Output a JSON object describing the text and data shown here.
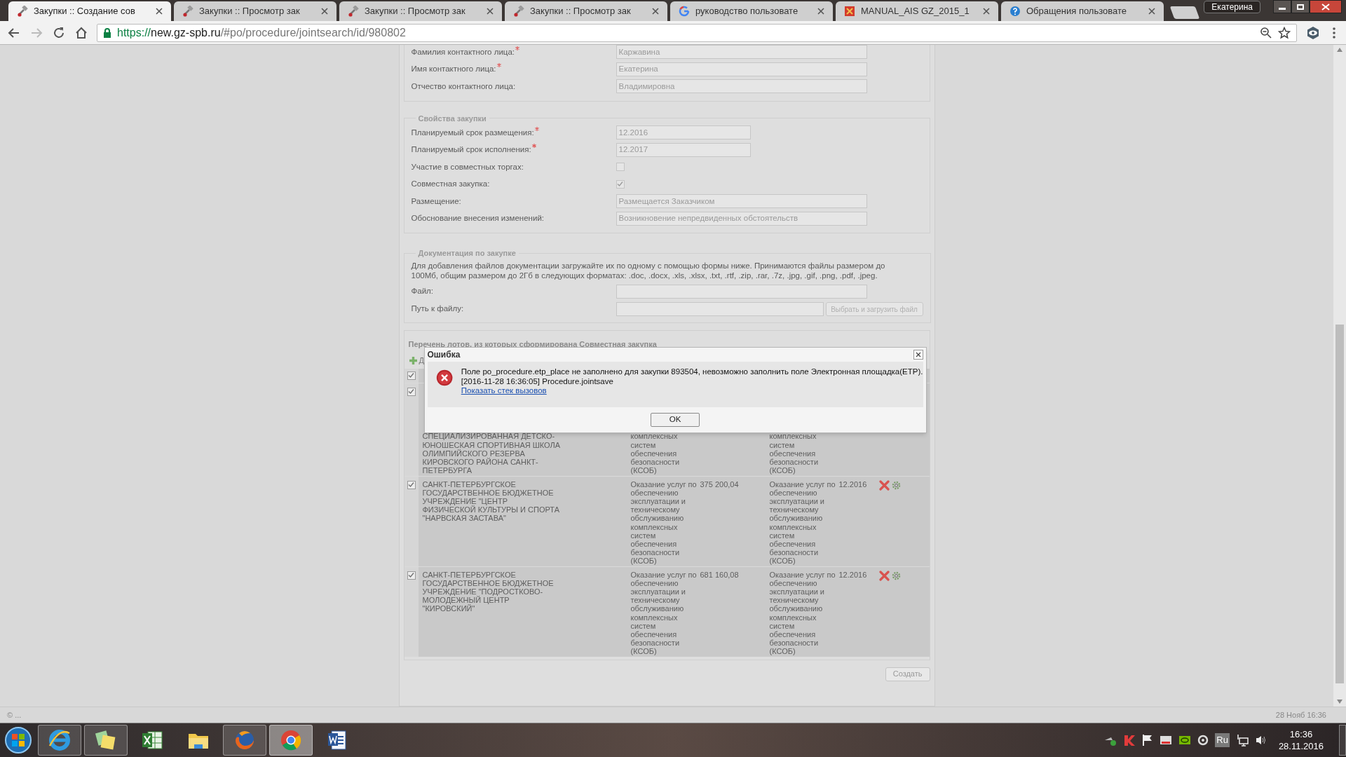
{
  "browser": {
    "tabs": [
      {
        "title": "Закупки :: Создание сов",
        "kind": "gavel",
        "selected": true
      },
      {
        "title": "Закупки :: Просмотр зак",
        "kind": "gavel",
        "selected": false
      },
      {
        "title": "Закупки :: Просмотр зак",
        "kind": "gavel",
        "selected": false
      },
      {
        "title": "Закупки :: Просмотр зак",
        "kind": "gavel",
        "selected": false
      },
      {
        "title": "руководство пользовате",
        "kind": "google",
        "selected": false
      },
      {
        "title": "MANUAL_AIS GZ_2015_1",
        "kind": "crest",
        "selected": false
      },
      {
        "title": "Обращения пользовате",
        "kind": "help",
        "selected": false
      }
    ],
    "profile": "Екатерина",
    "url": {
      "scheme": "https://",
      "host": "new.gz-spb.ru",
      "path": "/#po/procedure/jointsearch/id/980802"
    }
  },
  "sections": [
    {
      "rows": [
        {
          "label": "Фамилия контактного лица:",
          "required": true,
          "kind": "text",
          "value": "Каржавина"
        },
        {
          "label": "Имя контактного лица:",
          "required": true,
          "kind": "text",
          "value": "Екатерина"
        },
        {
          "label": "Отчество контактного лица:",
          "required": false,
          "kind": "text",
          "value": "Владимировна"
        }
      ]
    },
    {
      "legend": "Свойства закупки",
      "rows": [
        {
          "label": "Планируемый срок размещения:",
          "required": true,
          "kind": "short",
          "value": "12.2016"
        },
        {
          "label": "Планируемый срок исполнения:",
          "required": true,
          "kind": "short",
          "value": "12.2017"
        },
        {
          "label": "Участие в совместных торгах:",
          "required": false,
          "kind": "checkbox",
          "checked": false
        },
        {
          "label": "Совместная закупка:",
          "required": false,
          "kind": "checkbox",
          "checked": true
        },
        {
          "label": "Размещение:",
          "required": false,
          "kind": "text",
          "value": "Размещается Заказчиком"
        },
        {
          "label": "Обоснование внесения изменений:",
          "required": false,
          "kind": "text",
          "value": "Возникновение непредвиденных обстоятельств"
        }
      ]
    }
  ],
  "documents": {
    "legend": "Документация по закупке",
    "note": "Для добавления файлов документации загружайте их по одному с помощью формы ниже. Принимаются файлы размером до 100Мб, общим размером до 2Гб в следующих форматах: .doc, .docx, .xls, .xlsx, .txt, .rtf, .zip, .rar, .7z, .jpg, .gif, .png, .pdf, .jpeg.",
    "file_label": "Файл:",
    "path_label": "Путь к файлу:",
    "upload_button": "Выбрать и загрузить файл"
  },
  "lots": {
    "title": "Перечень лотов, из которых сформирована Совместная закупка",
    "add_label": "Д",
    "header_checked": true,
    "rows": [
      {
        "checked": true,
        "organization": "СПЕЦИАЛИЗИРОВАННАЯ ДЕТСКО-ЮНОШЕСКАЯ СПОРТИВНАЯ ШКОЛА ОЛИМПИЙСКОГО РЕЗЕРВА КИРОВСКОГО РАЙОНА САНКТ-ПЕТЕРБУРГА",
        "subject": "комплексных систем обеспечения безопасности (КСОБ)",
        "subject_2": "комплексных систем обеспечения безопасности (КСОБ)"
      },
      {
        "checked": true,
        "organization": "САНКТ-ПЕТЕРБУРГСКОЕ ГОСУДАРСТВЕННОЕ БЮДЖЕТНОЕ УЧРЕЖДЕНИЕ \"ЦЕНТР ФИЗИЧЕСКОЙ КУЛЬТУРЫ И СПОРТА \"НАРВСКАЯ ЗАСТАВА\"",
        "subject": "Оказание услуг по обеспечению эксплуатации и техническому обслуживанию комплексных систем обеспечения безопасности (КСОБ)",
        "price": "375 200,04",
        "subject_2": "Оказание услуг по обеспечению эксплуатации и техническому обслуживанию комплексных систем обеспечения безопасности (КСОБ)",
        "date": "12.2016"
      },
      {
        "checked": true,
        "organization": "САНКТ-ПЕТЕРБУРГСКОЕ ГОСУДАРСТВЕННОЕ БЮДЖЕТНОЕ УЧРЕЖДЕНИЕ \"ПОДРОСТКОВО-МОЛОДЕЖНЫЙ ЦЕНТР \"КИРОВСКИЙ\"",
        "subject": "Оказание услуг по обеспечению эксплуатации и техническому обслуживанию комплексных систем обеспечения безопасности (КСОБ)",
        "price": "681 160,08",
        "subject_2": "Оказание услуг по обеспечению эксплуатации и техническому обслуживанию комплексных систем обеспечения безопасности (КСОБ)",
        "date": "12.2016"
      }
    ]
  },
  "create_button": "Создать",
  "dialog": {
    "title": "Ошибка",
    "message": "Поле po_procedure.etp_place не заполнено для закупки 893504, невозможно заполнить поле Электронная площадка(ETP).",
    "detail": "[2016-11-28 16:36:05] Procedure.jointsave",
    "link": "Показать стек вызовов",
    "ok": "OK"
  },
  "status_bar": {
    "left": "© ...",
    "right": "28 Нояб 16:36"
  },
  "taskbar": {
    "apps": [
      {
        "kind": "ie",
        "running": true,
        "selected": false
      },
      {
        "kind": "notes",
        "running": true,
        "selected": false
      },
      {
        "kind": "excel",
        "running": false,
        "selected": false
      },
      {
        "kind": "explorer",
        "running": false,
        "selected": false
      },
      {
        "kind": "firefox",
        "running": true,
        "selected": false
      },
      {
        "kind": "chrome",
        "running": true,
        "selected": true
      },
      {
        "kind": "word",
        "running": false,
        "selected": false
      }
    ],
    "language": "Ru",
    "time": "16:36",
    "date": "28.11.2016"
  }
}
